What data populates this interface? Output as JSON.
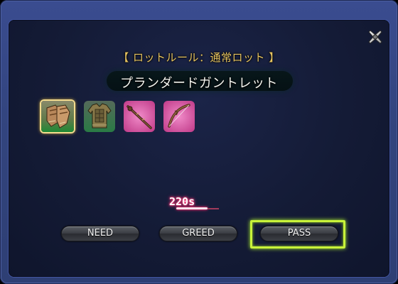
{
  "window": {
    "loot_rule": "【 ロットルール：通常ロット 】",
    "item_name": "プランダードガントレット"
  },
  "items": [
    {
      "icon": "gauntlets-icon",
      "selected": true,
      "background": "#2e8a3a"
    },
    {
      "icon": "body-armor-icon",
      "selected": false,
      "background": "#2e7a4a"
    },
    {
      "icon": "staff-icon",
      "selected": false,
      "background": "#d04a98"
    },
    {
      "icon": "bow-icon",
      "selected": false,
      "background": "#d04a98"
    }
  ],
  "timer": {
    "value": "220s",
    "progress": 0.73
  },
  "buttons": {
    "need": "NEED",
    "greed": "GREED",
    "pass": "PASS"
  },
  "colors": {
    "rule_text": "#e8c560",
    "highlight": "#c8f23a",
    "timer_glow": "#ff3b7a",
    "window_frame": "#3a4c90"
  }
}
